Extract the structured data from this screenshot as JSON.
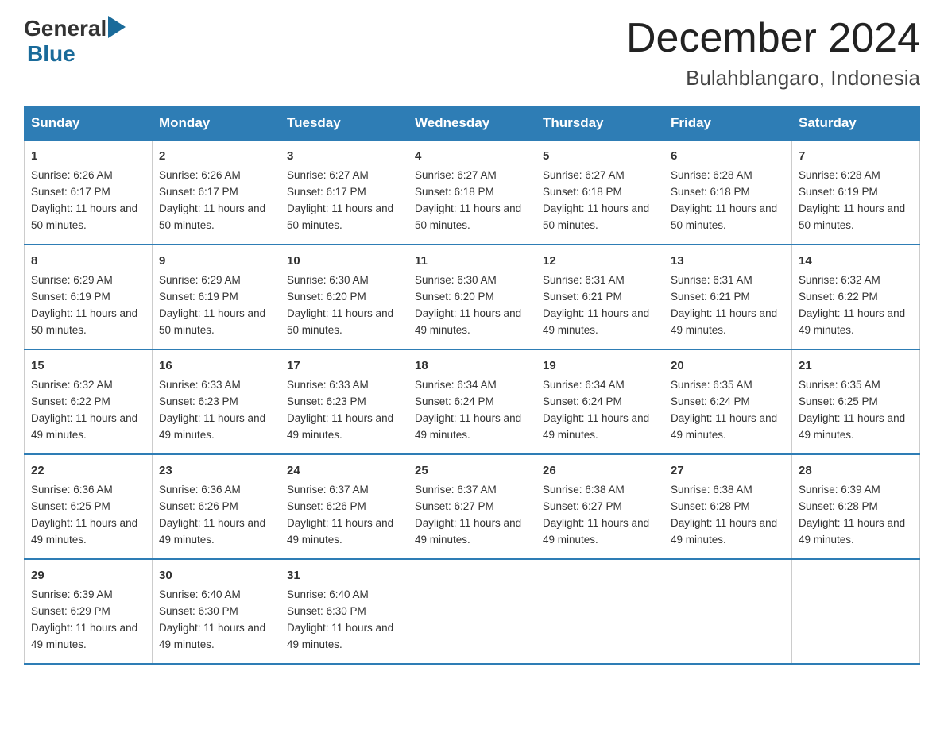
{
  "logo": {
    "general": "General",
    "arrow": "▶",
    "blue": "Blue"
  },
  "title": {
    "month_year": "December 2024",
    "location": "Bulahblangaro, Indonesia"
  },
  "days_header": [
    "Sunday",
    "Monday",
    "Tuesday",
    "Wednesday",
    "Thursday",
    "Friday",
    "Saturday"
  ],
  "weeks": [
    [
      {
        "day": "1",
        "sunrise": "Sunrise: 6:26 AM",
        "sunset": "Sunset: 6:17 PM",
        "daylight": "Daylight: 11 hours and 50 minutes."
      },
      {
        "day": "2",
        "sunrise": "Sunrise: 6:26 AM",
        "sunset": "Sunset: 6:17 PM",
        "daylight": "Daylight: 11 hours and 50 minutes."
      },
      {
        "day": "3",
        "sunrise": "Sunrise: 6:27 AM",
        "sunset": "Sunset: 6:17 PM",
        "daylight": "Daylight: 11 hours and 50 minutes."
      },
      {
        "day": "4",
        "sunrise": "Sunrise: 6:27 AM",
        "sunset": "Sunset: 6:18 PM",
        "daylight": "Daylight: 11 hours and 50 minutes."
      },
      {
        "day": "5",
        "sunrise": "Sunrise: 6:27 AM",
        "sunset": "Sunset: 6:18 PM",
        "daylight": "Daylight: 11 hours and 50 minutes."
      },
      {
        "day": "6",
        "sunrise": "Sunrise: 6:28 AM",
        "sunset": "Sunset: 6:18 PM",
        "daylight": "Daylight: 11 hours and 50 minutes."
      },
      {
        "day": "7",
        "sunrise": "Sunrise: 6:28 AM",
        "sunset": "Sunset: 6:19 PM",
        "daylight": "Daylight: 11 hours and 50 minutes."
      }
    ],
    [
      {
        "day": "8",
        "sunrise": "Sunrise: 6:29 AM",
        "sunset": "Sunset: 6:19 PM",
        "daylight": "Daylight: 11 hours and 50 minutes."
      },
      {
        "day": "9",
        "sunrise": "Sunrise: 6:29 AM",
        "sunset": "Sunset: 6:19 PM",
        "daylight": "Daylight: 11 hours and 50 minutes."
      },
      {
        "day": "10",
        "sunrise": "Sunrise: 6:30 AM",
        "sunset": "Sunset: 6:20 PM",
        "daylight": "Daylight: 11 hours and 50 minutes."
      },
      {
        "day": "11",
        "sunrise": "Sunrise: 6:30 AM",
        "sunset": "Sunset: 6:20 PM",
        "daylight": "Daylight: 11 hours and 49 minutes."
      },
      {
        "day": "12",
        "sunrise": "Sunrise: 6:31 AM",
        "sunset": "Sunset: 6:21 PM",
        "daylight": "Daylight: 11 hours and 49 minutes."
      },
      {
        "day": "13",
        "sunrise": "Sunrise: 6:31 AM",
        "sunset": "Sunset: 6:21 PM",
        "daylight": "Daylight: 11 hours and 49 minutes."
      },
      {
        "day": "14",
        "sunrise": "Sunrise: 6:32 AM",
        "sunset": "Sunset: 6:22 PM",
        "daylight": "Daylight: 11 hours and 49 minutes."
      }
    ],
    [
      {
        "day": "15",
        "sunrise": "Sunrise: 6:32 AM",
        "sunset": "Sunset: 6:22 PM",
        "daylight": "Daylight: 11 hours and 49 minutes."
      },
      {
        "day": "16",
        "sunrise": "Sunrise: 6:33 AM",
        "sunset": "Sunset: 6:23 PM",
        "daylight": "Daylight: 11 hours and 49 minutes."
      },
      {
        "day": "17",
        "sunrise": "Sunrise: 6:33 AM",
        "sunset": "Sunset: 6:23 PM",
        "daylight": "Daylight: 11 hours and 49 minutes."
      },
      {
        "day": "18",
        "sunrise": "Sunrise: 6:34 AM",
        "sunset": "Sunset: 6:24 PM",
        "daylight": "Daylight: 11 hours and 49 minutes."
      },
      {
        "day": "19",
        "sunrise": "Sunrise: 6:34 AM",
        "sunset": "Sunset: 6:24 PM",
        "daylight": "Daylight: 11 hours and 49 minutes."
      },
      {
        "day": "20",
        "sunrise": "Sunrise: 6:35 AM",
        "sunset": "Sunset: 6:24 PM",
        "daylight": "Daylight: 11 hours and 49 minutes."
      },
      {
        "day": "21",
        "sunrise": "Sunrise: 6:35 AM",
        "sunset": "Sunset: 6:25 PM",
        "daylight": "Daylight: 11 hours and 49 minutes."
      }
    ],
    [
      {
        "day": "22",
        "sunrise": "Sunrise: 6:36 AM",
        "sunset": "Sunset: 6:25 PM",
        "daylight": "Daylight: 11 hours and 49 minutes."
      },
      {
        "day": "23",
        "sunrise": "Sunrise: 6:36 AM",
        "sunset": "Sunset: 6:26 PM",
        "daylight": "Daylight: 11 hours and 49 minutes."
      },
      {
        "day": "24",
        "sunrise": "Sunrise: 6:37 AM",
        "sunset": "Sunset: 6:26 PM",
        "daylight": "Daylight: 11 hours and 49 minutes."
      },
      {
        "day": "25",
        "sunrise": "Sunrise: 6:37 AM",
        "sunset": "Sunset: 6:27 PM",
        "daylight": "Daylight: 11 hours and 49 minutes."
      },
      {
        "day": "26",
        "sunrise": "Sunrise: 6:38 AM",
        "sunset": "Sunset: 6:27 PM",
        "daylight": "Daylight: 11 hours and 49 minutes."
      },
      {
        "day": "27",
        "sunrise": "Sunrise: 6:38 AM",
        "sunset": "Sunset: 6:28 PM",
        "daylight": "Daylight: 11 hours and 49 minutes."
      },
      {
        "day": "28",
        "sunrise": "Sunrise: 6:39 AM",
        "sunset": "Sunset: 6:28 PM",
        "daylight": "Daylight: 11 hours and 49 minutes."
      }
    ],
    [
      {
        "day": "29",
        "sunrise": "Sunrise: 6:39 AM",
        "sunset": "Sunset: 6:29 PM",
        "daylight": "Daylight: 11 hours and 49 minutes."
      },
      {
        "day": "30",
        "sunrise": "Sunrise: 6:40 AM",
        "sunset": "Sunset: 6:30 PM",
        "daylight": "Daylight: 11 hours and 49 minutes."
      },
      {
        "day": "31",
        "sunrise": "Sunrise: 6:40 AM",
        "sunset": "Sunset: 6:30 PM",
        "daylight": "Daylight: 11 hours and 49 minutes."
      },
      null,
      null,
      null,
      null
    ]
  ]
}
